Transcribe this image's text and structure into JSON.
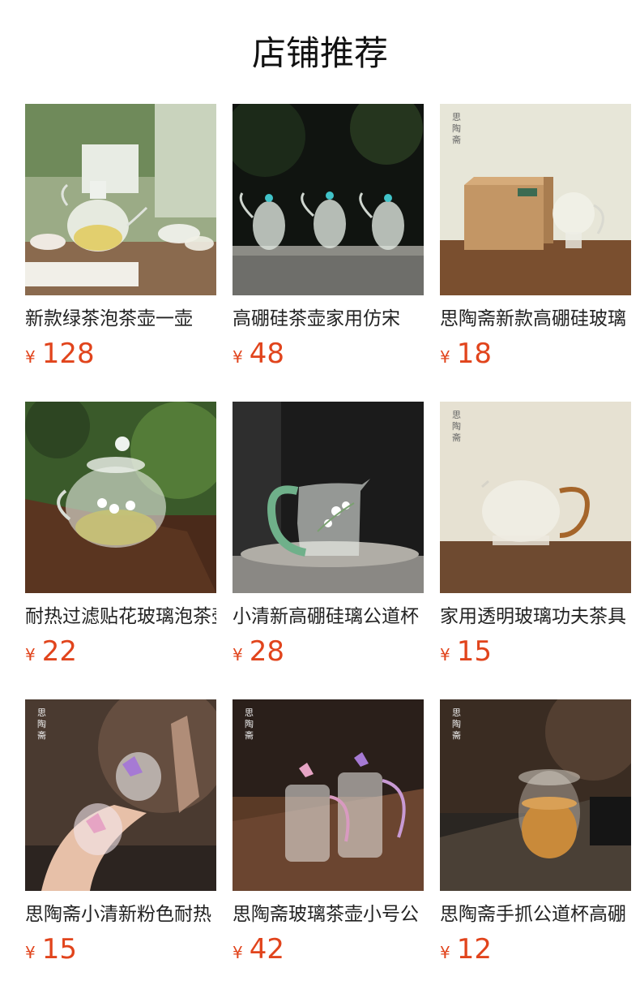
{
  "page": {
    "title": "店铺推荐"
  },
  "currency": "¥",
  "seal_text": "思陶斋",
  "products": [
    {
      "name": "新款绿茶泡茶壶一壶",
      "price": "128",
      "image": "glass-teapot-garden-photo"
    },
    {
      "name": "高硼硅茶壶家用仿宋",
      "price": "48",
      "image": "three-glass-teapots-photo"
    },
    {
      "name": "思陶斋新款高硼硅玻璃",
      "price": "18",
      "image": "glass-cup-with-box-photo"
    },
    {
      "name": "耐热过滤贴花玻璃泡茶壶",
      "price": "22",
      "image": "floral-glass-teapot-photo"
    },
    {
      "name": "小清新高硼硅璃公道杯",
      "price": "28",
      "image": "green-handle-pitcher-photo"
    },
    {
      "name": "家用透明玻璃功夫茶具",
      "price": "15",
      "image": "amber-handle-pitcher-photo"
    },
    {
      "name": "思陶斋小清新粉色耐热",
      "price": "15",
      "image": "butterfly-glass-cups-photo"
    },
    {
      "name": "思陶斋玻璃茶壶小号公",
      "price": "42",
      "image": "butterfly-glass-teapots-photo"
    },
    {
      "name": "思陶斋手抓公道杯高硼",
      "price": "12",
      "image": "glass-pitcher-tea-photo"
    }
  ]
}
